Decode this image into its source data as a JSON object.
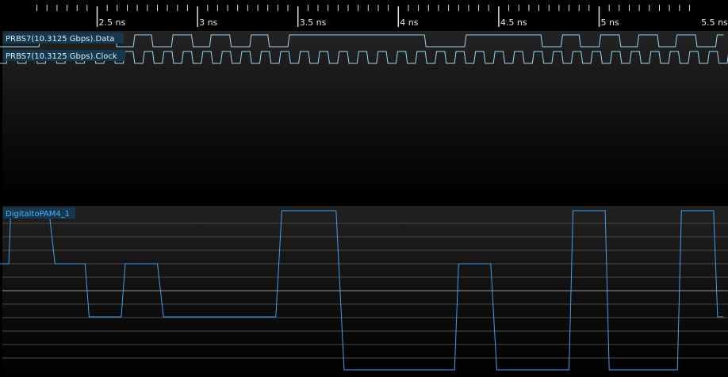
{
  "timeline": {
    "labels": [
      "2.5 ns",
      "3 ns",
      "3.5 ns",
      "4 ns",
      "4.5 ns",
      "5 ns",
      "5.5 ns"
    ]
  },
  "digital_panel": {
    "channels": [
      {
        "name": "PRBS7(10.3125 Gbps).Data",
        "color": "#9ad6f0"
      },
      {
        "name": "PRBS7(10.3125 Gbps).Clock",
        "color": "#9ad6f0"
      }
    ]
  },
  "analog_panel": {
    "channel": {
      "name": "DigitaltoPAM4_1",
      "color": "#3f9ff0"
    }
  },
  "colors": {
    "background": "#000000",
    "panel_gradient_top": "#222222",
    "panel_gradient_bottom": "#000000",
    "gridline": "#555555",
    "label_bg": "#15384f"
  },
  "chart_data": {
    "type": "line",
    "x_unit": "ns",
    "x_range": [
      2.0,
      5.62
    ],
    "digital": {
      "data_transitions_ns": [
        2.0,
        2.21,
        2.59,
        2.68,
        2.77,
        2.87,
        2.97,
        3.06,
        3.16,
        3.26,
        3.35,
        3.45,
        4.13,
        4.33,
        4.71,
        4.81,
        4.9,
        5.0,
        5.1,
        5.19,
        5.29,
        5.38,
        5.48,
        5.58
      ],
      "data_initial_level": 0,
      "clock_period_ns": 0.097,
      "clock_start_ns": 2.0
    },
    "analog": {
      "levels": 4,
      "points": [
        [
          2.0,
          1
        ],
        [
          2.06,
          1
        ],
        [
          2.07,
          2
        ],
        [
          2.26,
          2
        ],
        [
          2.29,
          1
        ],
        [
          2.44,
          1
        ],
        [
          2.46,
          0
        ],
        [
          2.62,
          0
        ],
        [
          2.64,
          1
        ],
        [
          2.8,
          1
        ],
        [
          2.83,
          0
        ],
        [
          3.39,
          0
        ],
        [
          3.42,
          2
        ],
        [
          3.69,
          2
        ],
        [
          3.73,
          -1
        ],
        [
          4.28,
          -1
        ],
        [
          4.3,
          1
        ],
        [
          4.46,
          1
        ],
        [
          4.49,
          -1
        ],
        [
          4.85,
          -1
        ],
        [
          4.87,
          2
        ],
        [
          5.03,
          2
        ],
        [
          5.05,
          -1
        ],
        [
          5.39,
          -1
        ],
        [
          5.41,
          2
        ],
        [
          5.57,
          2
        ],
        [
          5.59,
          0
        ],
        [
          5.62,
          0
        ]
      ]
    }
  }
}
